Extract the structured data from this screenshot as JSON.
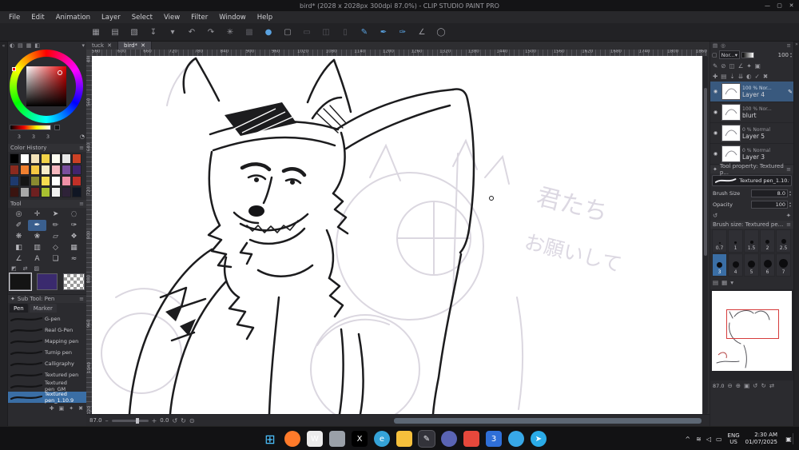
{
  "window": {
    "title": "bird* (2028 x 2028px 300dpi 87.0%) - CLIP STUDIO PAINT PRO",
    "controls": {
      "minimize": "—",
      "maximize": "▢",
      "close": "✕"
    }
  },
  "menubar": {
    "items": [
      "File",
      "Edit",
      "Animation",
      "Layer",
      "Select",
      "View",
      "Filter",
      "Window",
      "Help"
    ]
  },
  "toolbar": {
    "icons": [
      {
        "name": "workspace-icon",
        "glyph": "▦",
        "cls": "normal"
      },
      {
        "name": "new-canvas-icon",
        "glyph": "▤",
        "cls": "normal"
      },
      {
        "name": "open-file-icon",
        "glyph": "▧",
        "cls": "normal"
      },
      {
        "name": "save-icon",
        "glyph": "↧",
        "cls": "normal"
      },
      {
        "name": "save-options-chevron-icon",
        "glyph": "▾",
        "cls": "normal"
      },
      {
        "name": "undo-icon",
        "glyph": "↶",
        "cls": "normal"
      },
      {
        "name": "redo-icon",
        "glyph": "↷",
        "cls": "normal"
      },
      {
        "name": "filter-sparkle-icon",
        "glyph": "✳",
        "cls": "normal"
      },
      {
        "name": "grid-icon",
        "glyph": "▩",
        "cls": "disabled"
      },
      {
        "name": "blend-drop-icon",
        "glyph": "●",
        "cls": "accent"
      },
      {
        "name": "crop-frame-icon",
        "glyph": "▢",
        "cls": "normal"
      },
      {
        "name": "select-rect-icon",
        "glyph": "▭",
        "cls": "disabled"
      },
      {
        "name": "select-invert-icon",
        "glyph": "◫",
        "cls": "disabled"
      },
      {
        "name": "deselect-icon",
        "glyph": "▯",
        "cls": "disabled"
      },
      {
        "name": "pen-draw-icon",
        "glyph": "✎",
        "cls": "active"
      },
      {
        "name": "brush-draw-icon",
        "glyph": "✒",
        "cls": "active"
      },
      {
        "name": "marker-draw-icon",
        "glyph": "✑",
        "cls": "active"
      },
      {
        "name": "ruler-icon",
        "glyph": "∠",
        "cls": "normal"
      },
      {
        "name": "ellipse-icon",
        "glyph": "◯",
        "cls": "normal"
      }
    ]
  },
  "left_strip": {
    "collapse_glyph": "«"
  },
  "right_strip": {
    "collapse_glyph": "»"
  },
  "left_panel": {
    "tab_icons": [
      {
        "name": "color-wheel-tab-icon",
        "glyph": "◐"
      },
      {
        "name": "color-slider-tab-icon",
        "glyph": "▤"
      },
      {
        "name": "color-set-tab-icon",
        "glyph": "▦"
      },
      {
        "name": "color-mixer-tab-icon",
        "glyph": "◧"
      }
    ],
    "panel_chevron": "▾"
  },
  "color_panel": {
    "values": [
      "3",
      "3",
      "3"
    ],
    "picker_glyph": "◔",
    "history_title": "Color History",
    "swatches": [
      "#000000",
      "#ffffff",
      "#f2e2b8",
      "#f2d348",
      "#fdfdf2",
      "#e8e8e8",
      "#cc4125",
      "#8a2a1e",
      "#f08030",
      "#f5c842",
      "#f7ecc8",
      "#f5b8c0",
      "#7a4f9e",
      "#41256e",
      "#1e3a6e",
      "#141414",
      "#8a8a30",
      "#f5dc50",
      "#ffffff",
      "#f090a8",
      "#c03028",
      "#3a1410",
      "#a8a8a8",
      "#6e2020",
      "#a8c030",
      "#f0f0f0",
      "#2e2238",
      "#101624"
    ]
  },
  "tools": {
    "title": "Tool",
    "icons": [
      {
        "name": "zoom-tool-icon",
        "glyph": "◎"
      },
      {
        "name": "move-tool-icon",
        "glyph": "✛"
      },
      {
        "name": "operation-tool-icon",
        "glyph": "➤"
      },
      {
        "name": "lasso-tool-icon",
        "glyph": "◌"
      },
      {
        "name": "eyedropper-tool-icon",
        "glyph": "✐"
      },
      {
        "name": "pen-tool-icon",
        "glyph": "✒",
        "cls": "selected"
      },
      {
        "name": "pencil-tool-icon",
        "glyph": "✏"
      },
      {
        "name": "brush-tool-icon",
        "glyph": "✑"
      },
      {
        "name": "airbrush-tool-icon",
        "glyph": "❋"
      },
      {
        "name": "decoration-tool-icon",
        "glyph": "❀"
      },
      {
        "name": "eraser-tool-icon",
        "glyph": "▱"
      },
      {
        "name": "blend-tool-icon",
        "glyph": "❖"
      },
      {
        "name": "fill-tool-icon",
        "glyph": "◧"
      },
      {
        "name": "gradient-tool-icon",
        "glyph": "▥"
      },
      {
        "name": "figure-tool-icon",
        "glyph": "◇"
      },
      {
        "name": "frame-tool-icon",
        "glyph": "▦"
      },
      {
        "name": "ruler-tool-icon",
        "glyph": "∠"
      },
      {
        "name": "text-tool-icon",
        "glyph": "A"
      },
      {
        "name": "balloon-tool-icon",
        "glyph": "❏"
      },
      {
        "name": "correction-tool-icon",
        "glyph": "≈"
      }
    ],
    "mini_icons": [
      {
        "name": "default-colors-icon",
        "glyph": "◩"
      },
      {
        "name": "switch-colors-icon",
        "glyph": "⇄"
      },
      {
        "name": "transparent-color-icon",
        "glyph": "▨"
      }
    ]
  },
  "main_colors": {
    "primary": "#141414",
    "secondary": "#3a2a6e"
  },
  "subtool": {
    "title": "Sub Tool: Pen",
    "header_icon_glyph": "✦",
    "menu_glyph": "≡",
    "tabs": [
      {
        "label": "Pen",
        "cls": "active"
      },
      {
        "label": "Marker",
        "cls": "plain"
      }
    ],
    "brushes": [
      {
        "name": "G-pen"
      },
      {
        "name": "Real G-Pen"
      },
      {
        "name": "Mapping pen"
      },
      {
        "name": "Turnip pen"
      },
      {
        "name": "Calligraphy"
      },
      {
        "name": "Textured pen"
      },
      {
        "name": "Textured pen_GM"
      },
      {
        "name": "Textured pen_1.10.9",
        "cls": "selected"
      }
    ],
    "footer_icons": [
      {
        "name": "add-subtool-icon",
        "glyph": "✚"
      },
      {
        "name": "duplicate-subtool-icon",
        "glyph": "▣"
      },
      {
        "name": "subtool-settings-icon",
        "glyph": "✦"
      },
      {
        "name": "delete-subtool-icon",
        "glyph": "✖"
      }
    ]
  },
  "doc_tabs": {
    "close_glyph": "✕",
    "tabs": [
      {
        "label": "tuck",
        "cls": "plain"
      },
      {
        "label": "bird*",
        "cls": "active"
      }
    ]
  },
  "ruler": {
    "top_labels": [
      "560",
      "600",
      "660",
      "720",
      "780",
      "840",
      "900",
      "960",
      "1020",
      "1080",
      "1140",
      "1200",
      "1260",
      "1320",
      "1380",
      "1440",
      "1500",
      "1560",
      "1620",
      "1680",
      "1740",
      "1800",
      "1860"
    ],
    "left_labels": [
      "480",
      "560",
      "640",
      "720",
      "800",
      "880",
      "960",
      "1040",
      "1120"
    ]
  },
  "canvas": {
    "annotations": [
      "君たち",
      "お願いして"
    ]
  },
  "statusbar": {
    "zoom_value": "87.0",
    "zoom_out_glyph": "–",
    "zoom_in_glyph": "+",
    "angle_value": "0.0",
    "rotate_ccw_glyph": "↺",
    "rotate_cw_glyph": "↻",
    "reset_glyph": "⊙"
  },
  "layers": {
    "tab_icons": [
      {
        "name": "layer-list-tab-icon",
        "glyph": "▤"
      },
      {
        "name": "layer-search-tab-icon",
        "glyph": "◎"
      }
    ],
    "menu_glyph": "≡",
    "select_glyph": "▢",
    "blend_mode": "Nor...",
    "blend_chevron": "▾",
    "opacity_value": "100",
    "stepper_up": "▴",
    "stepper_down": "▾",
    "lock_icons": [
      {
        "name": "layer-lock-icon",
        "glyph": "✎"
      },
      {
        "name": "lock-transparent-icon",
        "glyph": "⊘"
      },
      {
        "name": "layer-mask-icon",
        "glyph": "◫"
      },
      {
        "name": "layer-ruler-icon",
        "glyph": "∠"
      },
      {
        "name": "layer-draft-icon",
        "glyph": "✦"
      },
      {
        "name": "layer-palette-icon",
        "glyph": "▣"
      }
    ],
    "cmd_icons": [
      {
        "name": "new-raster-layer-icon",
        "glyph": "✚"
      },
      {
        "name": "new-folder-icon",
        "glyph": "▤"
      },
      {
        "name": "transfer-down-icon",
        "glyph": "⇣"
      },
      {
        "name": "merge-down-icon",
        "glyph": "⇊"
      },
      {
        "name": "create-mask-icon",
        "glyph": "◐"
      },
      {
        "name": "apply-mask-icon",
        "glyph": "✓"
      },
      {
        "name": "delete-layer-icon",
        "glyph": "✖"
      }
    ],
    "eye_glyph": "◉",
    "edit_glyph": "✎",
    "items": [
      {
        "mode": "100 % Nor...",
        "name": "Layer 4",
        "cls": "selected"
      },
      {
        "mode": "100 % Nor...",
        "name": "blurt",
        "cls": "plain"
      },
      {
        "mode": "0 % Normal",
        "name": "Layer 5",
        "cls": "plain"
      },
      {
        "mode": "0 % Normal",
        "name": "Layer 3",
        "cls": "plain"
      }
    ]
  },
  "tool_property": {
    "title": "Tool property: Textured p...",
    "header_icon_glyph": "✦",
    "menu_glyph": "≡",
    "brush_name": "Textured pen_1.10.9",
    "lock_glyph": "▣",
    "rows": [
      {
        "label": "Brush Size",
        "value": "8.0"
      },
      {
        "label": "Opacity",
        "value": "100"
      }
    ],
    "footer_left_glyph": "↺",
    "footer_right_glyph": "✦"
  },
  "brush_size_panel": {
    "title": "Brush size: Textured pe...",
    "menu_glyph": "≡",
    "sizes": [
      {
        "label": "0.7",
        "cls": "plain"
      },
      {
        "label": "1",
        "cls": "plain"
      },
      {
        "label": "1.5",
        "cls": "plain"
      },
      {
        "label": "2",
        "cls": "plain"
      },
      {
        "label": "2.5",
        "cls": "plain"
      },
      {
        "label": "3",
        "cls": "selected"
      },
      {
        "label": "4",
        "cls": "plain"
      },
      {
        "label": "5",
        "cls": "plain"
      },
      {
        "label": "6",
        "cls": "plain"
      },
      {
        "label": "7",
        "cls": "plain"
      }
    ],
    "footer_icons": [
      {
        "name": "size-list-view-icon",
        "glyph": "▤"
      },
      {
        "name": "size-grid-view-icon",
        "glyph": "▦"
      },
      {
        "name": "size-panel-chevron-icon",
        "glyph": "▾"
      }
    ]
  },
  "navigator": {
    "zoom_value": "87.0",
    "controls": [
      {
        "name": "nav-zoom-out-icon",
        "glyph": "⊖"
      },
      {
        "name": "nav-zoom-in-icon",
        "glyph": "⊕"
      },
      {
        "name": "nav-fit-icon",
        "glyph": "▣"
      },
      {
        "name": "nav-rotate-ccw-icon",
        "glyph": "↺"
      },
      {
        "name": "nav-rotate-cw-icon",
        "glyph": "↻"
      },
      {
        "name": "nav-flip-icon",
        "glyph": "⇄"
      }
    ]
  },
  "taskbar": {
    "apps": [
      {
        "name": "start-button",
        "glyph": "⊞",
        "color": "transparent",
        "shape": "start"
      },
      {
        "name": "firefox-icon",
        "glyph": "",
        "color": "#ff7a2a",
        "shape": "circle"
      },
      {
        "name": "app-w-icon",
        "glyph": "W",
        "color": "#ececec",
        "shape": "square",
        "fg": "#333333"
      },
      {
        "name": "app-gray-icon",
        "glyph": "",
        "color": "#9aa0a8",
        "shape": "square"
      },
      {
        "name": "x-app-icon",
        "glyph": "X",
        "color": "#000000",
        "shape": "square"
      },
      {
        "name": "edge-icon",
        "glyph": "e",
        "color": "#35a3d8",
        "shape": "circle"
      },
      {
        "name": "file-explorer-icon",
        "glyph": "",
        "color": "#f6c03c",
        "shape": "square"
      },
      {
        "name": "clip-studio-icon",
        "glyph": "✎",
        "color": "#2e2e33",
        "shape": "square active"
      },
      {
        "name": "discord-icon",
        "glyph": "",
        "color": "#5a64b4",
        "shape": "circle"
      },
      {
        "name": "red-app-icon",
        "glyph": "",
        "color": "#e6483c",
        "shape": "square"
      },
      {
        "name": "blue-3-app-icon",
        "glyph": "3",
        "color": "#2f6fd8",
        "shape": "square"
      },
      {
        "name": "blue-app-icon",
        "glyph": "",
        "color": "#38a8e8",
        "shape": "circle"
      },
      {
        "name": "telegram-icon",
        "glyph": "➤",
        "color": "#2aabe8",
        "shape": "circle"
      }
    ],
    "tray": {
      "chevron": "^",
      "icons": [
        {
          "name": "network-icon",
          "glyph": "≋"
        },
        {
          "name": "volume-icon",
          "glyph": "◁"
        },
        {
          "name": "battery-icon",
          "glyph": "▭"
        }
      ],
      "lang_line1": "ENG",
      "lang_line2": "US",
      "time": "2:30 AM",
      "date": "01/07/2025",
      "notification_glyph": "▣"
    }
  }
}
